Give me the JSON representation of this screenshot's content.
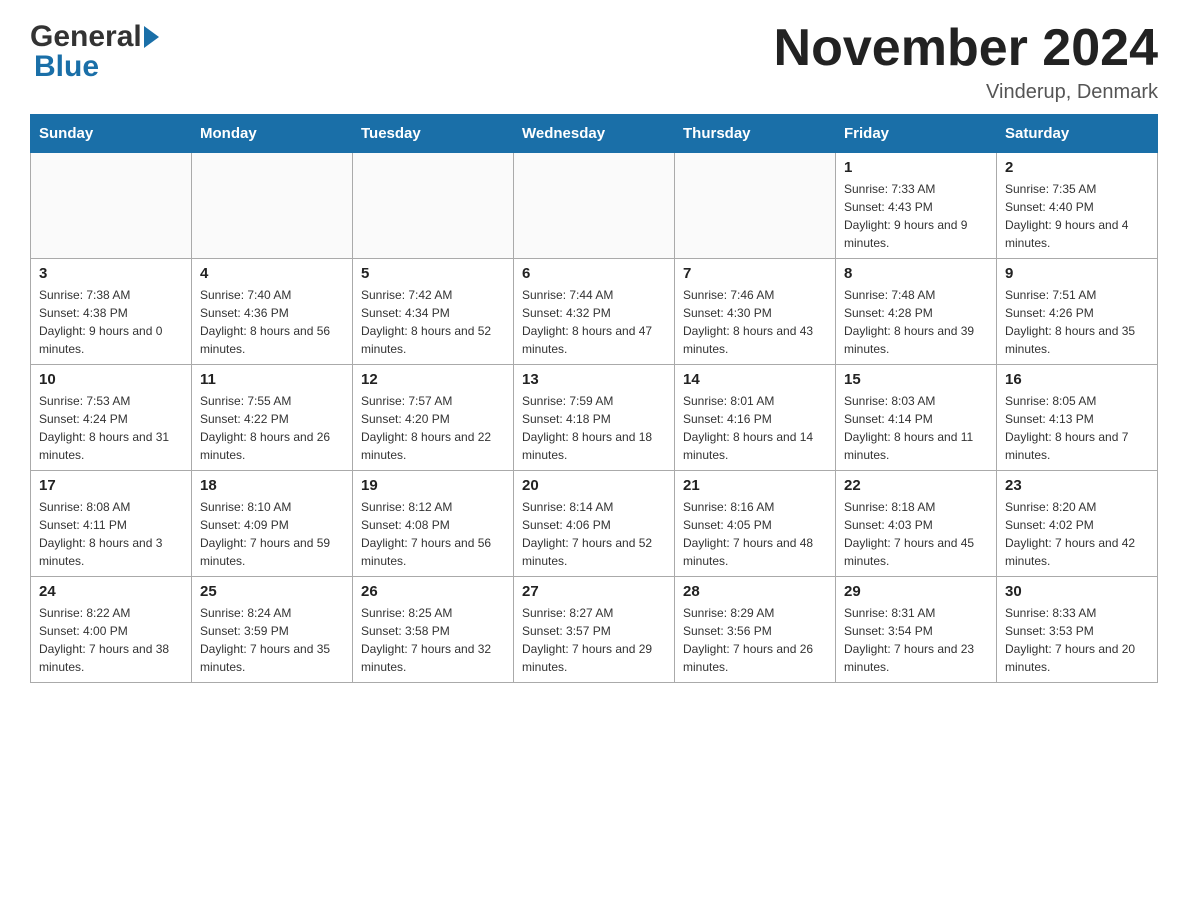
{
  "header": {
    "title": "November 2024",
    "location": "Vinderup, Denmark",
    "logo_general": "General",
    "logo_blue": "Blue"
  },
  "days_of_week": [
    "Sunday",
    "Monday",
    "Tuesday",
    "Wednesday",
    "Thursday",
    "Friday",
    "Saturday"
  ],
  "weeks": [
    [
      {
        "day": "",
        "info": ""
      },
      {
        "day": "",
        "info": ""
      },
      {
        "day": "",
        "info": ""
      },
      {
        "day": "",
        "info": ""
      },
      {
        "day": "",
        "info": ""
      },
      {
        "day": "1",
        "info": "Sunrise: 7:33 AM\nSunset: 4:43 PM\nDaylight: 9 hours and 9 minutes."
      },
      {
        "day": "2",
        "info": "Sunrise: 7:35 AM\nSunset: 4:40 PM\nDaylight: 9 hours and 4 minutes."
      }
    ],
    [
      {
        "day": "3",
        "info": "Sunrise: 7:38 AM\nSunset: 4:38 PM\nDaylight: 9 hours and 0 minutes."
      },
      {
        "day": "4",
        "info": "Sunrise: 7:40 AM\nSunset: 4:36 PM\nDaylight: 8 hours and 56 minutes."
      },
      {
        "day": "5",
        "info": "Sunrise: 7:42 AM\nSunset: 4:34 PM\nDaylight: 8 hours and 52 minutes."
      },
      {
        "day": "6",
        "info": "Sunrise: 7:44 AM\nSunset: 4:32 PM\nDaylight: 8 hours and 47 minutes."
      },
      {
        "day": "7",
        "info": "Sunrise: 7:46 AM\nSunset: 4:30 PM\nDaylight: 8 hours and 43 minutes."
      },
      {
        "day": "8",
        "info": "Sunrise: 7:48 AM\nSunset: 4:28 PM\nDaylight: 8 hours and 39 minutes."
      },
      {
        "day": "9",
        "info": "Sunrise: 7:51 AM\nSunset: 4:26 PM\nDaylight: 8 hours and 35 minutes."
      }
    ],
    [
      {
        "day": "10",
        "info": "Sunrise: 7:53 AM\nSunset: 4:24 PM\nDaylight: 8 hours and 31 minutes."
      },
      {
        "day": "11",
        "info": "Sunrise: 7:55 AM\nSunset: 4:22 PM\nDaylight: 8 hours and 26 minutes."
      },
      {
        "day": "12",
        "info": "Sunrise: 7:57 AM\nSunset: 4:20 PM\nDaylight: 8 hours and 22 minutes."
      },
      {
        "day": "13",
        "info": "Sunrise: 7:59 AM\nSunset: 4:18 PM\nDaylight: 8 hours and 18 minutes."
      },
      {
        "day": "14",
        "info": "Sunrise: 8:01 AM\nSunset: 4:16 PM\nDaylight: 8 hours and 14 minutes."
      },
      {
        "day": "15",
        "info": "Sunrise: 8:03 AM\nSunset: 4:14 PM\nDaylight: 8 hours and 11 minutes."
      },
      {
        "day": "16",
        "info": "Sunrise: 8:05 AM\nSunset: 4:13 PM\nDaylight: 8 hours and 7 minutes."
      }
    ],
    [
      {
        "day": "17",
        "info": "Sunrise: 8:08 AM\nSunset: 4:11 PM\nDaylight: 8 hours and 3 minutes."
      },
      {
        "day": "18",
        "info": "Sunrise: 8:10 AM\nSunset: 4:09 PM\nDaylight: 7 hours and 59 minutes."
      },
      {
        "day": "19",
        "info": "Sunrise: 8:12 AM\nSunset: 4:08 PM\nDaylight: 7 hours and 56 minutes."
      },
      {
        "day": "20",
        "info": "Sunrise: 8:14 AM\nSunset: 4:06 PM\nDaylight: 7 hours and 52 minutes."
      },
      {
        "day": "21",
        "info": "Sunrise: 8:16 AM\nSunset: 4:05 PM\nDaylight: 7 hours and 48 minutes."
      },
      {
        "day": "22",
        "info": "Sunrise: 8:18 AM\nSunset: 4:03 PM\nDaylight: 7 hours and 45 minutes."
      },
      {
        "day": "23",
        "info": "Sunrise: 8:20 AM\nSunset: 4:02 PM\nDaylight: 7 hours and 42 minutes."
      }
    ],
    [
      {
        "day": "24",
        "info": "Sunrise: 8:22 AM\nSunset: 4:00 PM\nDaylight: 7 hours and 38 minutes."
      },
      {
        "day": "25",
        "info": "Sunrise: 8:24 AM\nSunset: 3:59 PM\nDaylight: 7 hours and 35 minutes."
      },
      {
        "day": "26",
        "info": "Sunrise: 8:25 AM\nSunset: 3:58 PM\nDaylight: 7 hours and 32 minutes."
      },
      {
        "day": "27",
        "info": "Sunrise: 8:27 AM\nSunset: 3:57 PM\nDaylight: 7 hours and 29 minutes."
      },
      {
        "day": "28",
        "info": "Sunrise: 8:29 AM\nSunset: 3:56 PM\nDaylight: 7 hours and 26 minutes."
      },
      {
        "day": "29",
        "info": "Sunrise: 8:31 AM\nSunset: 3:54 PM\nDaylight: 7 hours and 23 minutes."
      },
      {
        "day": "30",
        "info": "Sunrise: 8:33 AM\nSunset: 3:53 PM\nDaylight: 7 hours and 20 minutes."
      }
    ]
  ]
}
